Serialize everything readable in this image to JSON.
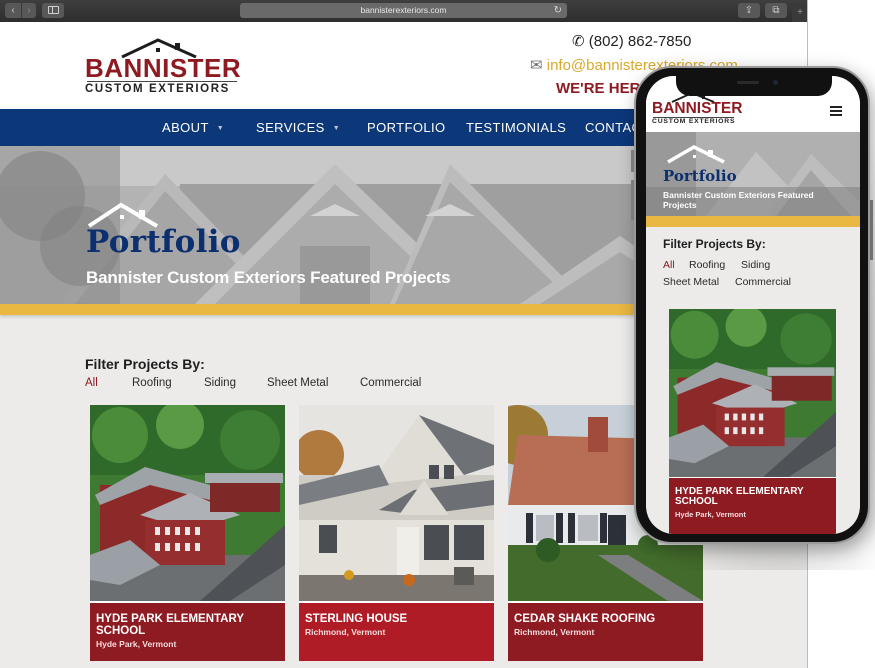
{
  "browser": {
    "url": "bannisterexteriors.com",
    "icons": {
      "back": "chevron-left-icon",
      "forward": "chevron-right-icon",
      "sidebar": "sidebar-icon",
      "reload": "reload-icon",
      "share": "share-icon",
      "tabs": "tabs-icon",
      "new_tab": "plus-icon"
    },
    "glyphs": {
      "back": "‹",
      "forward": "›",
      "reload": "↻",
      "share": "⇪",
      "tabs": "⧉",
      "new_tab": "+"
    }
  },
  "site": {
    "logo": {
      "name": "BANNISTER",
      "subtitle": "CUSTOM EXTERIORS"
    },
    "contact": {
      "phone": "(802) 862-7850",
      "email": "info@bannisterexteriors.com",
      "tagline": "WE'RE HERE",
      "phone_glyph": "✆",
      "email_glyph": "✉"
    },
    "nav": [
      {
        "label": "ABOUT",
        "has_dropdown": true
      },
      {
        "label": "SERVICES",
        "has_dropdown": true
      },
      {
        "label": "PORTFOLIO",
        "has_dropdown": false
      },
      {
        "label": "TESTIMONIALS",
        "has_dropdown": false
      },
      {
        "label": "CONTACT",
        "has_dropdown": false
      }
    ],
    "caret_glyph": "▼",
    "hero": {
      "title": "Portfolio",
      "subtitle": "Bannister Custom Exteriors Featured Projects"
    },
    "filters": {
      "title": "Filter Projects By:",
      "options": [
        "All",
        "Roofing",
        "Siding",
        "Sheet Metal",
        "Commercial"
      ],
      "active": "All"
    },
    "projects": [
      {
        "title": "HYDE PARK ELEMENTARY SCHOOL",
        "location": "Hyde Park, Vermont",
        "color": "#8e1a22"
      },
      {
        "title": "STERLING HOUSE",
        "location": "Richmond, Vermont",
        "color": "#b01c26"
      },
      {
        "title": "CEDAR SHAKE ROOFING",
        "location": "Richmond, Vermont",
        "color": "#8e1a22"
      }
    ]
  },
  "mobile": {
    "logo": {
      "name": "BANNISTER",
      "subtitle": "CUSTOM EXTERIORS"
    },
    "menu_icon": "hamburger-menu-icon",
    "hero": {
      "title": "Portfolio",
      "subtitle": "Bannister Custom Exteriors Featured Projects"
    },
    "filters": {
      "title": "Filter Projects By:",
      "options": [
        "All",
        "Roofing",
        "Siding",
        "Sheet Metal",
        "Commercial"
      ],
      "active": "All"
    },
    "project": {
      "title": "HYDE PARK ELEMENTARY SCHOOL",
      "location": "Hyde Park, Vermont"
    }
  },
  "colors": {
    "brand_red": "#8e1a22",
    "nav_blue": "#0c3779",
    "title_blue": "#0c2f6f",
    "gold": "#e9b843",
    "page_bg": "#ecebea"
  }
}
